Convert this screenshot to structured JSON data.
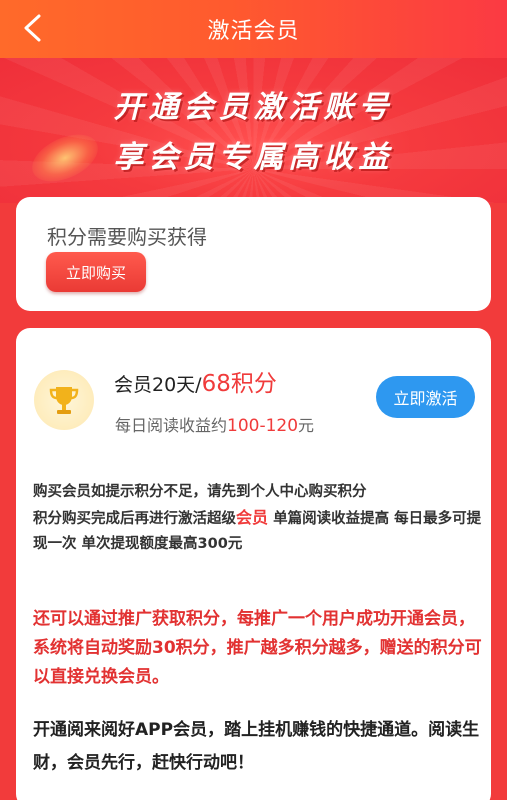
{
  "header": {
    "title": "激活会员",
    "back_icon": "chevron-left-icon"
  },
  "banner": {
    "line1": "开通会员激活账号",
    "line2": "享会员专属高收益"
  },
  "points_card": {
    "text": "积分需要购买获得",
    "buy_label": "立即购买"
  },
  "plan_card": {
    "icon": "trophy-icon",
    "plan_prefix": "会员20天/",
    "plan_price": "68积分",
    "income_prefix": "每日阅读收益约",
    "income_range": "100-120",
    "income_suffix": "元",
    "activate_label": "立即激活"
  },
  "info": {
    "line1": "购买会员如提示积分不足，请先到个人中心购买积分",
    "part1": "积分购买完成后再进行激活超级",
    "highlight": "会员",
    "part2": " 单篇阅读收益提高 每日最多可提现一次 单次提现额度最高300元"
  },
  "promo": {
    "text": "还可以通过推广获取积分，每推广一个用户成功开通会员，系统将自动奖励30积分，推广越多积分越多，赠送的积分可以直接兑换会员。"
  },
  "closing": {
    "text": "开通阅来阅好APP会员，踏上挂机赚钱的快捷通道。阅读生财，会员先行，赶快行动吧！"
  },
  "colors": {
    "accent_red": "#f03b3b",
    "header_orange": "#ff6a2a",
    "activate_blue": "#2e98f0"
  }
}
